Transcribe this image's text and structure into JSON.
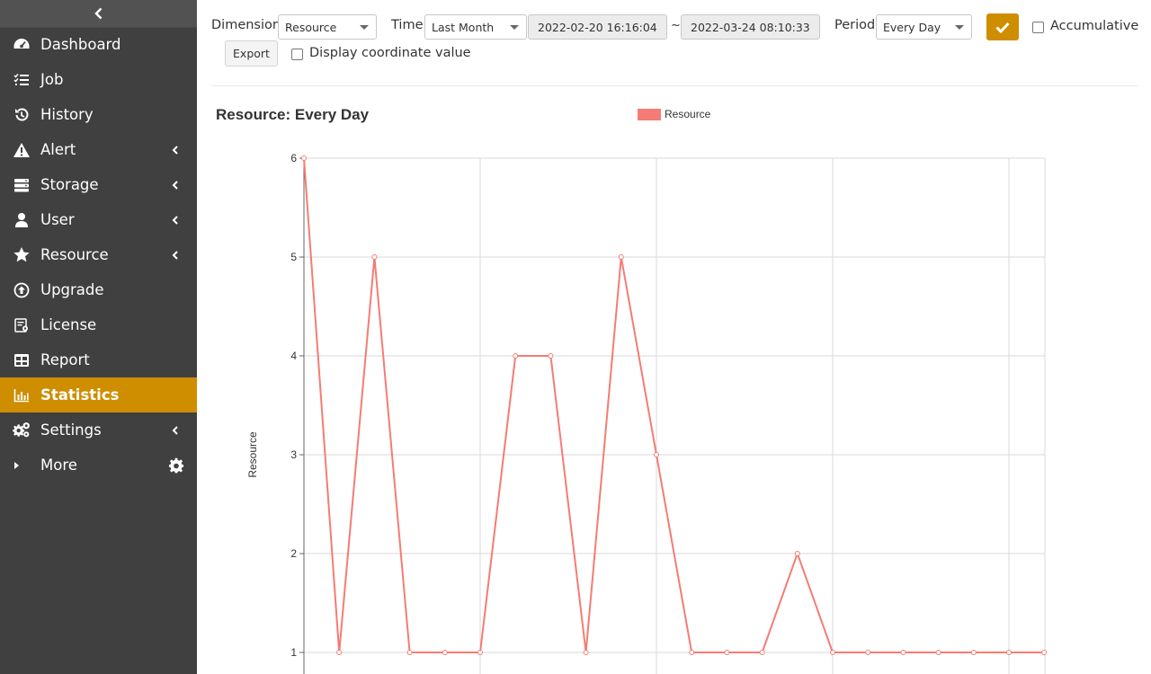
{
  "sidebar": {
    "collapse_icon": "chevron-left-icon",
    "items": [
      {
        "label": "Dashboard",
        "icon": "tachometer-icon",
        "submenu": false
      },
      {
        "label": "Job",
        "icon": "task-list-icon",
        "submenu": false
      },
      {
        "label": "History",
        "icon": "history-icon",
        "submenu": false
      },
      {
        "label": "Alert",
        "icon": "warning-icon",
        "submenu": true
      },
      {
        "label": "Storage",
        "icon": "server-icon",
        "submenu": true
      },
      {
        "label": "User",
        "icon": "user-icon",
        "submenu": true
      },
      {
        "label": "Resource",
        "icon": "star-icon",
        "submenu": true
      },
      {
        "label": "Upgrade",
        "icon": "upgrade-icon",
        "submenu": false
      },
      {
        "label": "License",
        "icon": "license-icon",
        "submenu": false
      },
      {
        "label": "Report",
        "icon": "table-icon",
        "submenu": false
      },
      {
        "label": "Statistics",
        "icon": "bar-chart-icon",
        "submenu": false,
        "active": true
      },
      {
        "label": "Settings",
        "icon": "gears-icon",
        "submenu": true
      },
      {
        "label": "More",
        "icon": "caret-right-icon",
        "submenu": false,
        "trailing_icon": "gear-icon"
      }
    ],
    "active_color": "#cf8d00",
    "background_color": "#404040"
  },
  "toolbar": {
    "dimension_label": "Dimension:",
    "dimension_value": "Resource",
    "time_label": "Time:",
    "time_value": "Last Month",
    "start_date": "2022-02-20 16:16:04",
    "range_separator": "~",
    "end_date": "2022-03-24 08:10:33",
    "period_label": "Period:",
    "period_value": "Every Day",
    "apply_icon": "check-icon",
    "accumulative_label": "Accumulative",
    "accumulative_checked": false,
    "export_label": "Export",
    "display_coordinate_label": "Display coordinate value",
    "display_coordinate_checked": false
  },
  "chart_data": {
    "type": "line",
    "title": "Resource: Every Day",
    "ylabel": "Resource",
    "xlabel": "",
    "legend_placement": "top",
    "grid": true,
    "ylim": [
      1,
      6
    ],
    "yticks": [
      "1",
      "2",
      "3",
      "4",
      "5",
      "6"
    ],
    "series": [
      {
        "name": "Resource",
        "color": "#f47c74",
        "values": [
          6,
          1,
          5,
          1,
          1,
          1,
          4,
          4,
          1,
          5,
          3,
          1,
          1,
          1,
          2,
          1,
          1,
          1,
          1,
          1,
          1,
          1
        ]
      }
    ]
  }
}
